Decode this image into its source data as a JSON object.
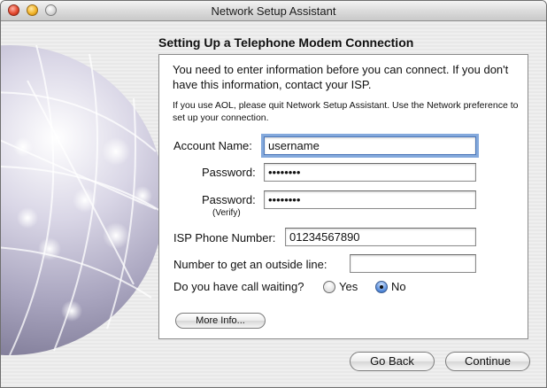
{
  "window": {
    "title": "Network Setup Assistant"
  },
  "heading": "Setting Up a Telephone Modem Connection",
  "intro_text": "You need to enter information before you can connect. If you don't have this information, contact your ISP.",
  "aol_text": "If you use AOL, please quit Network Setup Assistant. Use the Network preference to set up your connection.",
  "form": {
    "account_name": {
      "label": "Account Name:",
      "value": "username"
    },
    "password": {
      "label": "Password:",
      "value": "••••••••"
    },
    "password_verify": {
      "label": "Password:",
      "sublabel": "(Verify)",
      "value": "••••••••"
    },
    "isp_phone": {
      "label": "ISP Phone Number:",
      "value": "01234567890"
    },
    "outside_line": {
      "label": "Number to get an outside line:",
      "value": ""
    },
    "call_waiting": {
      "label": "Do you have call waiting?",
      "yes_label": "Yes",
      "no_label": "No",
      "selected": "No"
    }
  },
  "buttons": {
    "more_info": "More Info...",
    "go_back": "Go Back",
    "continue": "Continue"
  },
  "icons": {
    "window_controls": [
      "close-icon",
      "minimize-icon",
      "zoom-icon"
    ],
    "illustration": "network-globe-icon"
  }
}
